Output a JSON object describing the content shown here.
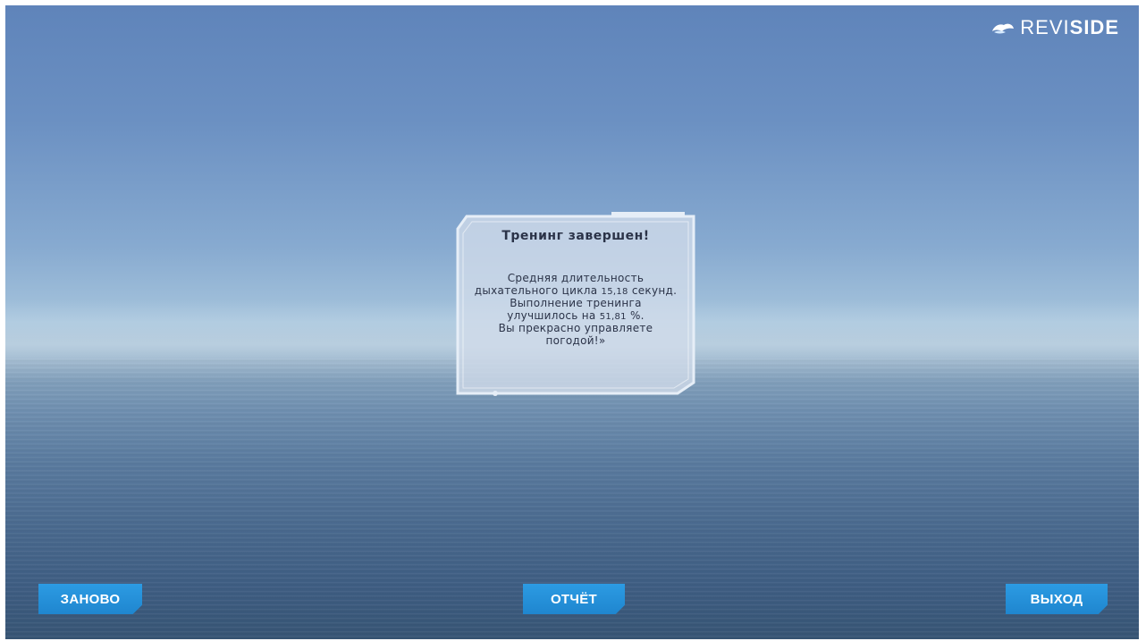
{
  "brand": {
    "thin": "REVI",
    "bold": "SIDE",
    "icon": "cloud-icon"
  },
  "dialog": {
    "title": "Тренинг завершен!",
    "line1": "Средняя длительность",
    "line2_prefix": "дыхательного цикла",
    "avg_cycle_seconds": "15,18",
    "line2_suffix": "секунд.",
    "line3": "Выполнение тренинга",
    "line4_prefix": "улучшилось на",
    "improvement_percent": "51,81",
    "line4_suffix": "%.",
    "line5": "Вы прекрасно управляете",
    "line6": "погодой!»"
  },
  "buttons": {
    "again": "ЗАНОВО",
    "report": "ОТЧЁТ",
    "exit": "ВЫХОД"
  },
  "colors": {
    "button": "#1f86cf",
    "dialog_border": "#dbe6f2",
    "dialog_fill": "#d2dceb"
  }
}
